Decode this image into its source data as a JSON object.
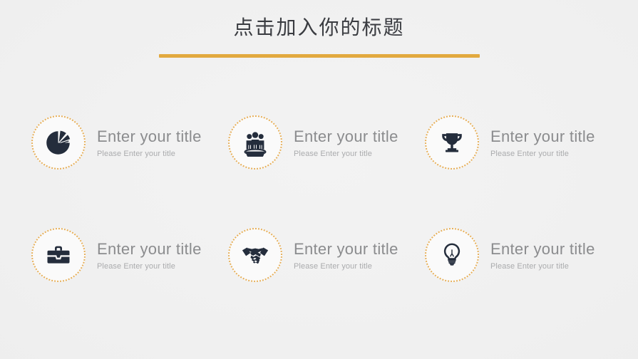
{
  "slide": {
    "background_color": "#f0f0f0",
    "title": "点击加入你的标题",
    "title_color": "#3a3c41",
    "accent_color": "#e2a93f",
    "rule_color": "#e2a93f",
    "circle_border_color": "#e7b05a",
    "icon_color": "#242d3c"
  },
  "features": [
    {
      "icon": "pie-chart-icon",
      "title": "Enter your title",
      "subtitle": "Please Enter your title"
    },
    {
      "icon": "team-group-icon",
      "title": "Enter your title",
      "subtitle": "Please Enter your title"
    },
    {
      "icon": "trophy-icon",
      "title": "Enter your title",
      "subtitle": "Please Enter your title"
    },
    {
      "icon": "briefcase-icon",
      "title": "Enter your title",
      "subtitle": "Please Enter your title"
    },
    {
      "icon": "handshake-icon",
      "title": "Enter your title",
      "subtitle": "Please Enter your title"
    },
    {
      "icon": "lightbulb-icon",
      "title": "Enter your title",
      "subtitle": "Please Enter your title"
    }
  ]
}
